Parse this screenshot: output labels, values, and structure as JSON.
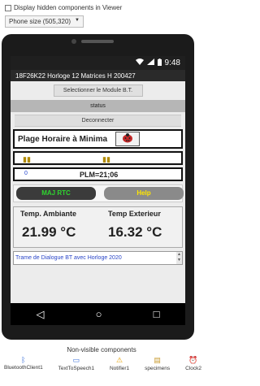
{
  "designer": {
    "hidden_checkbox_label": "Display hidden components in Viewer",
    "size_select": "Phone size (505,320)"
  },
  "status": {
    "time": "9:48"
  },
  "app": {
    "title": "18F26K22 Horloge 12 Matrices H 200427"
  },
  "controls": {
    "select_button": "Selectionner le Module B.T.",
    "status_label": "status",
    "disconnect_button": "Deconnecter"
  },
  "plage": {
    "title": "Plage Horaire à Minima"
  },
  "plm": {
    "num": "0",
    "value": "PLM=21;06"
  },
  "buttons": {
    "maj": "MAJ RTC",
    "help": "Help"
  },
  "temps": {
    "ambiante_label": "Temp. Ambiante",
    "ambiante_value": "21.99 °C",
    "exterieur_label": "Temp Exterieur",
    "exterieur_value": "16.32 °C"
  },
  "trame": {
    "text": "Trame de Dialogue BT avec Horloge 2020"
  },
  "nonvisible": {
    "title": "Non-visible components",
    "items": [
      "BluetoothClient1",
      "TextToSpeech1",
      "Notifier1",
      "specimens",
      "Clock2"
    ]
  },
  "icons": {
    "wifi": "wifi-icon",
    "signal": "signal-icon",
    "battery": "battery-icon",
    "back": "back-icon",
    "home": "home-icon",
    "recents": "recents-icon",
    "ladybug": "ladybug-icon"
  },
  "colors": {
    "maj_text": "#2fd52f",
    "help_text": "#ffe600",
    "trame_text": "#2a46c8"
  }
}
